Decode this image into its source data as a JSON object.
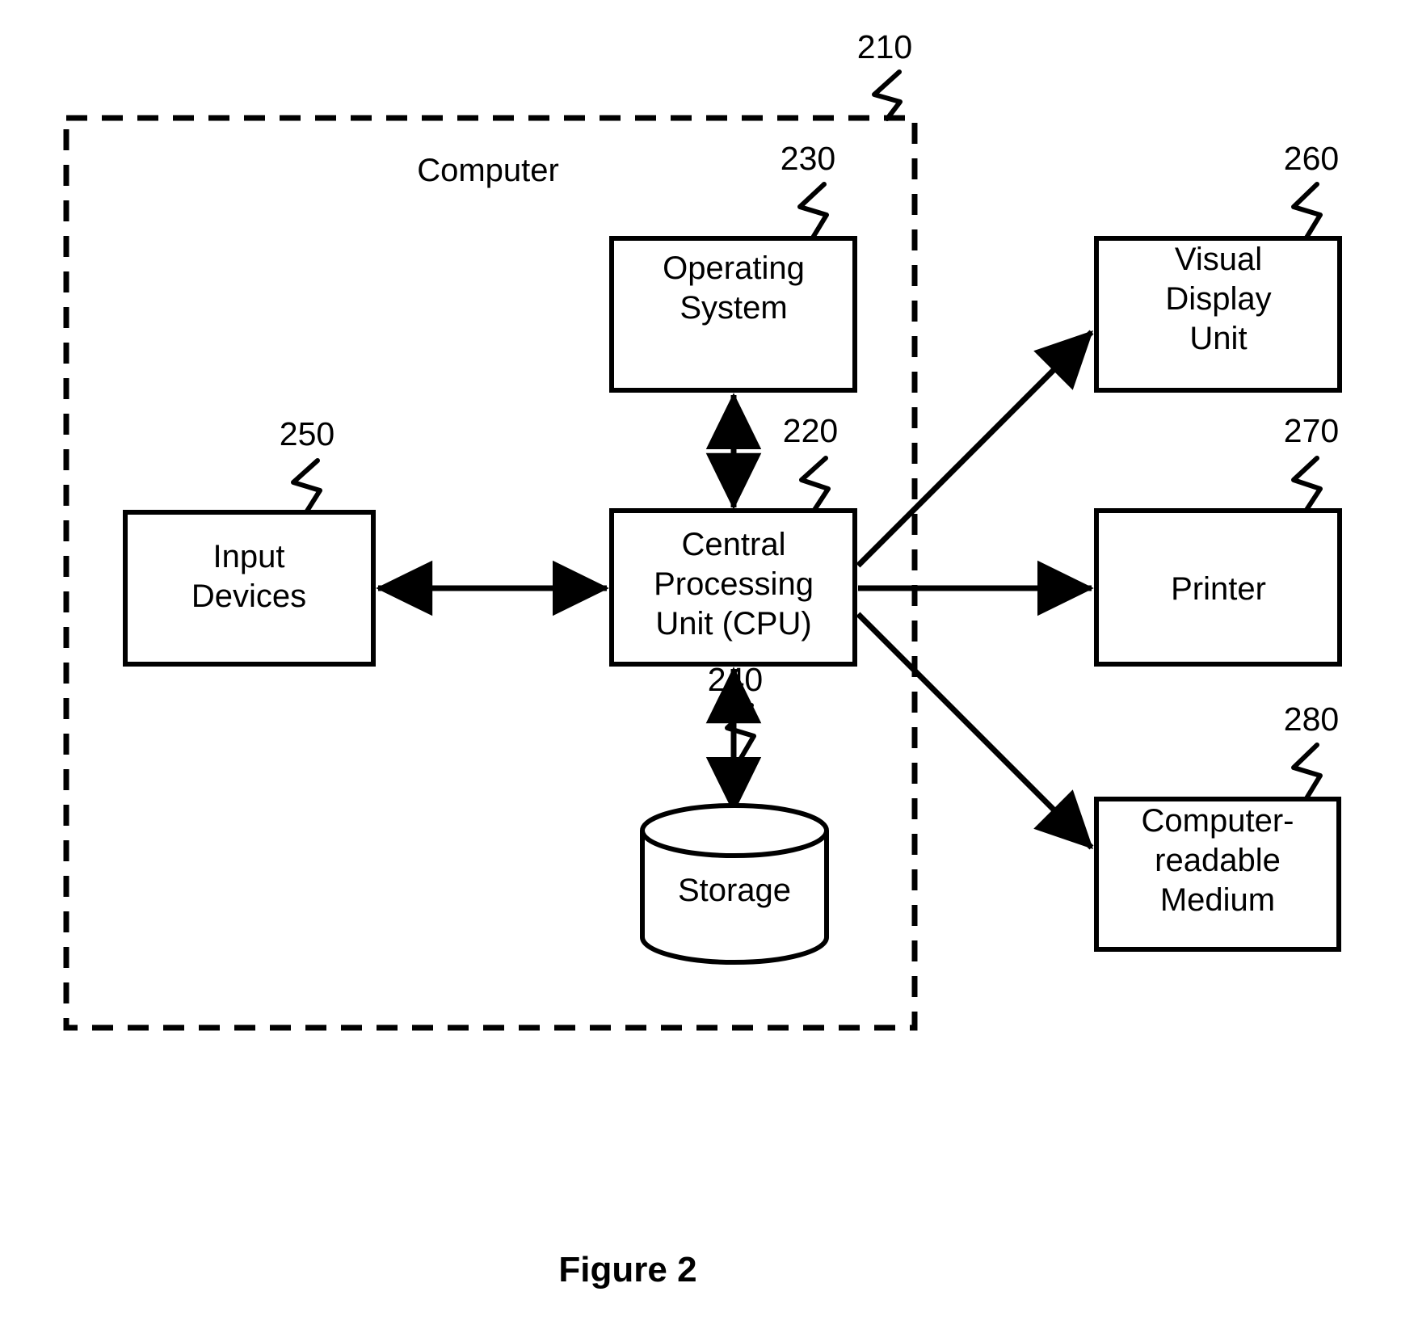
{
  "figure": {
    "caption": "Figure 2",
    "boundary_label": "Computer",
    "boundary_ref": "210",
    "line_color": "#000000",
    "background_color": "#ffffff"
  },
  "nodes": [
    {
      "id": "operating-system",
      "ref": "230",
      "shape": "rect",
      "lines": [
        "Operating",
        "System"
      ]
    },
    {
      "id": "central-processing-unit",
      "ref": "220",
      "shape": "rect",
      "lines": [
        "Central",
        "Processing",
        "Unit (CPU)"
      ]
    },
    {
      "id": "input-devices",
      "ref": "250",
      "shape": "rect",
      "lines": [
        "Input",
        "Devices"
      ]
    },
    {
      "id": "storage",
      "ref": "240",
      "shape": "cylinder",
      "lines": [
        "Storage"
      ]
    },
    {
      "id": "visual-display-unit",
      "ref": "260",
      "shape": "rect",
      "lines": [
        "Visual",
        "Display",
        "Unit"
      ]
    },
    {
      "id": "printer",
      "ref": "270",
      "shape": "rect",
      "lines": [
        "Printer"
      ]
    },
    {
      "id": "computer-readable-medium",
      "ref": "280",
      "shape": "rect",
      "lines": [
        "Computer-",
        "readable",
        "Medium"
      ]
    }
  ],
  "connections": [
    {
      "id": "cpu-operating-system",
      "from": "central-processing-unit",
      "to": "operating-system",
      "arrow": "both"
    },
    {
      "id": "input-devices-cpu",
      "from": "input-devices",
      "to": "central-processing-unit",
      "arrow": "both"
    },
    {
      "id": "cpu-storage",
      "from": "central-processing-unit",
      "to": "storage",
      "arrow": "both"
    },
    {
      "id": "cpu-visual-display-unit",
      "from": "central-processing-unit",
      "to": "visual-display-unit",
      "arrow": "end"
    },
    {
      "id": "cpu-printer",
      "from": "central-processing-unit",
      "to": "printer",
      "arrow": "end"
    },
    {
      "id": "cpu-computer-readable-medium",
      "from": "central-processing-unit",
      "to": "computer-readable-medium",
      "arrow": "end"
    }
  ]
}
